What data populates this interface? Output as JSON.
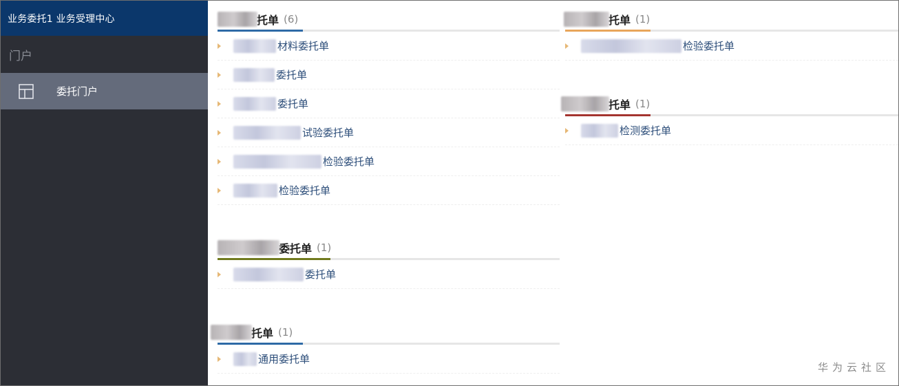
{
  "sidebar": {
    "header": "业务委托1  业务受理中心",
    "section": "门户",
    "items": [
      {
        "label": "委托门户",
        "icon": "layout-grid-icon"
      }
    ]
  },
  "groups": [
    {
      "title": "托单",
      "count": "(6)",
      "accent": "#2e6aa6",
      "items": [
        "材料委托单",
        "委托单",
        "委托单",
        "试验委托单",
        "检验委托单",
        "检验委托单"
      ]
    },
    {
      "title": "委托单",
      "count": "(1)",
      "accent": "#707a1e",
      "items": [
        "委托单"
      ]
    },
    {
      "title": "托单",
      "count": "(1)",
      "accent": "#2e6aa6",
      "items": [
        "通用委托单"
      ]
    },
    {
      "title": "托单",
      "count": "(1)",
      "accent": "#e8a55a",
      "items": [
        "检验委托单"
      ]
    },
    {
      "title": "托单",
      "count": "(1)",
      "accent": "#a4342f",
      "items": [
        "检测委托单"
      ]
    }
  ],
  "watermark": "华为云社区"
}
